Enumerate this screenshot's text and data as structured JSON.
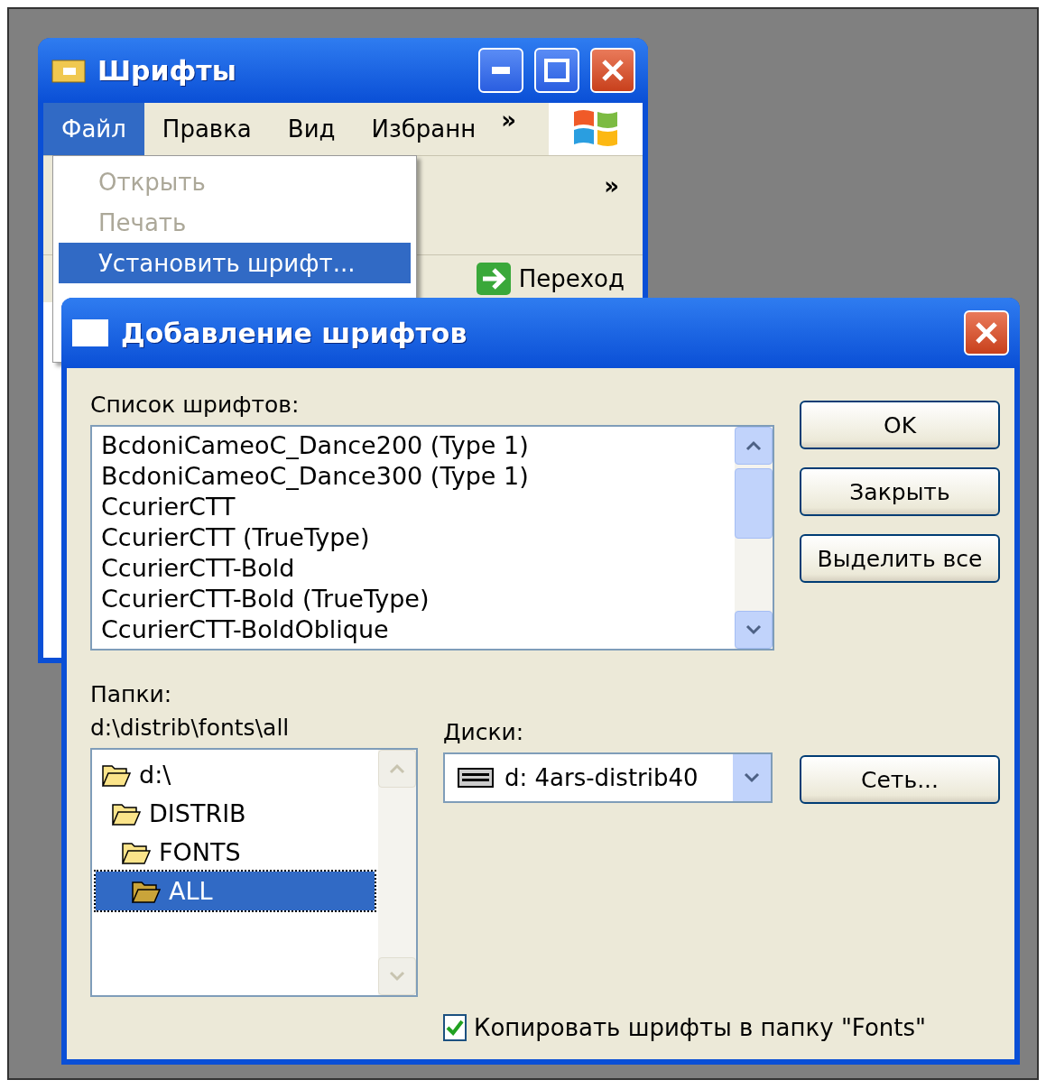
{
  "background_window": {
    "title": "Шрифты",
    "menu": [
      {
        "label": "Файл",
        "selected": true
      },
      {
        "label": "Правка",
        "selected": false
      },
      {
        "label": "Вид",
        "selected": false
      },
      {
        "label": "Избранн",
        "selected": false
      }
    ],
    "menu_overflow": "»",
    "toolbar_overflow": "»",
    "go_button": "Переход"
  },
  "file_menu": [
    {
      "label": "Открыть",
      "disabled": true,
      "selected": false
    },
    {
      "label": "Печать",
      "disabled": true,
      "selected": false
    },
    {
      "label": "Установить шрифт...",
      "disabled": false,
      "selected": true
    }
  ],
  "dialog": {
    "title": "Добавление шрифтов",
    "font_list_label": "Список шрифтов:",
    "fonts": [
      "BcdoniCameoC_Dance200 (Type 1)",
      "BcdoniCameoC_Dance300 (Type 1)",
      "CcurierCTT",
      "CcurierCTT (TrueType)",
      "CcurierCTT-Bold",
      "CcurierCTT-Bold (TrueType)",
      "CcurierCTT-BoldOblique"
    ],
    "buttons": [
      "OK",
      "Закрыть",
      "Выделить все"
    ],
    "folders_label": "Папки:",
    "current_path": "d:\\distrib\\fonts\\all",
    "folders": [
      {
        "name": "d:\\",
        "selected": false,
        "children": [
          {
            "name": "DISTRIB",
            "selected": false,
            "children": [
              {
                "name": "FONTS",
                "selected": false,
                "children": [
                  {
                    "name": "ALL",
                    "selected": true
                  }
                ]
              }
            ]
          }
        ]
      }
    ],
    "drives_label": "Диски:",
    "drive": "d: 4ars-distrib40",
    "network_button": "Сеть...",
    "copy_checkbox": {
      "label": "Копировать шрифты в папку \"Fonts\"",
      "checked": true
    }
  }
}
